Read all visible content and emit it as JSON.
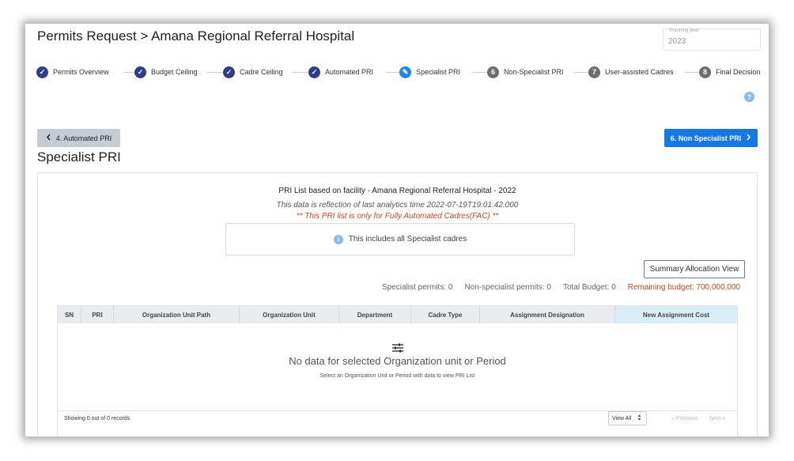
{
  "header": {
    "title": "Permits Request > Amana Regional Referral Hospital",
    "planning_year_label": "Planning year",
    "planning_year_value": "2023"
  },
  "stepper": {
    "steps": [
      {
        "label": "Permits Overview",
        "state": "done",
        "badge": "✓"
      },
      {
        "label": "Budget Ceiling",
        "state": "done",
        "badge": "✓"
      },
      {
        "label": "Cadre Ceiling",
        "state": "done",
        "badge": "✓"
      },
      {
        "label": "Automated PRI",
        "state": "done",
        "badge": "✓"
      },
      {
        "label": "Specialist PRI",
        "state": "active",
        "badge": "✎"
      },
      {
        "label": "Non-Specialist PRI",
        "state": "todo",
        "badge": "6"
      },
      {
        "label": "User-assisted Cadres",
        "state": "todo",
        "badge": "7"
      },
      {
        "label": "Final Decision",
        "state": "todo",
        "badge": "8"
      }
    ]
  },
  "nav": {
    "back_label": "4. Automated PRI",
    "next_label": "6. Non Specialist PRI"
  },
  "page_heading": "Specialist PRI",
  "panel": {
    "title": "PRI List based on facility - Amana Regional Referral Hospital - 2022",
    "analytics_note": "This data is reflection of last analytics time 2022-07-19T19:01:42.000",
    "warning": "** This PRI list is only for Fully Automated Cadres(FAC) **",
    "info": "This includes all Specialist cadres",
    "summary_button": "Summary Allocation View",
    "stats": {
      "specialist": "Specialist permits: 0",
      "non_specialist": "Non-specialist permits: 0",
      "total_budget": "Total Budget: 0",
      "remaining": "Remaining budget: 700,000,000"
    }
  },
  "table": {
    "columns": [
      "SN",
      "PRI",
      "Organization Unit Path",
      "Organization Unit",
      "Department",
      "Cadre Type",
      "Assignment Designation",
      "New Assignment Cost"
    ],
    "empty_title": "No data for selected Organization unit or Period",
    "empty_subtitle": "Select an Organization Unit or Period with data to view PRI List",
    "showing": "Showing 0 out of 0 records",
    "view_all": "View All",
    "previous": "« Previous",
    "next": "Next »"
  },
  "colors": {
    "done": "#2d3e8e",
    "active": "#1e88e5",
    "todo": "#6e6e6e",
    "primary": "#1677e6",
    "warning": "#c9491b"
  },
  "icons": {
    "back": "chevron-left-icon",
    "next": "chevron-right-icon",
    "help": "question-icon",
    "info": "info-icon",
    "empty": "sliders-icon"
  }
}
